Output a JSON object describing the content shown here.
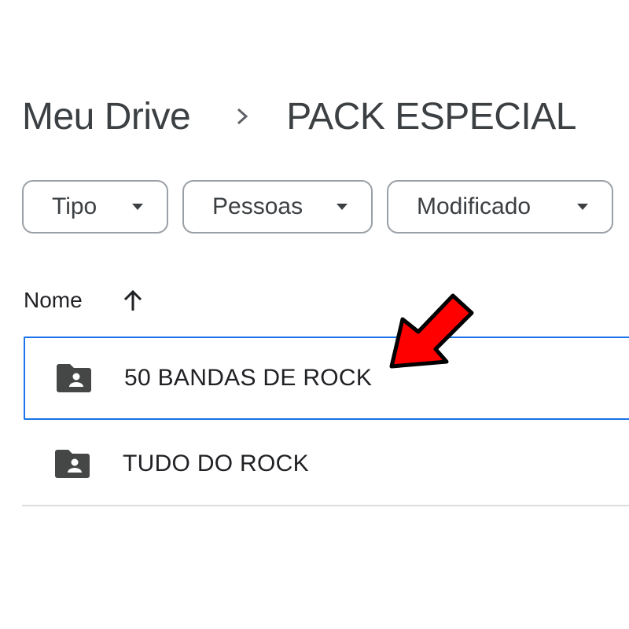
{
  "breadcrumb": {
    "root": "Meu Drive",
    "separator_icon": "chevron-right-icon",
    "current": "PACK ESPECIAL"
  },
  "filters": [
    {
      "label": "Tipo",
      "icon": "caret-down-icon"
    },
    {
      "label": "Pessoas",
      "icon": "caret-down-icon"
    },
    {
      "label": "Modificado",
      "icon": "caret-down-icon"
    }
  ],
  "list": {
    "column_header": "Nome",
    "sort_icon": "arrow-up-icon",
    "items": [
      {
        "name": "50 BANDAS DE ROCK",
        "icon": "shared-folder-icon",
        "selected": true
      },
      {
        "name": "TUDO DO ROCK",
        "icon": "shared-folder-icon",
        "selected": false
      }
    ]
  },
  "annotation": {
    "icon": "red-arrow-icon",
    "color": "#ff0000"
  },
  "colors": {
    "selection_border": "#1a73e8",
    "text": "#3c4043",
    "chip_border": "#9aa0a6",
    "divider": "#dadce0"
  }
}
